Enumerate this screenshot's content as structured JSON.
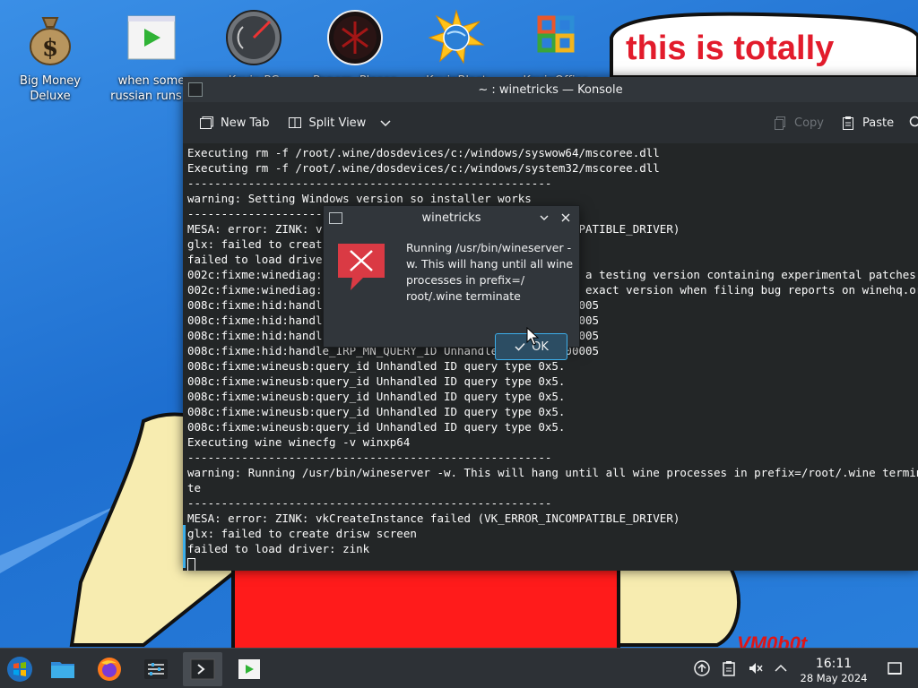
{
  "desktop": {
    "icons": [
      {
        "label": "Big Money Deluxe",
        "icon": "money-bag-icon"
      },
      {
        "label": "when some russian runs a",
        "icon": "video-player-icon"
      },
      {
        "label": "Kevin PC",
        "icon": "speedometer-icon"
      },
      {
        "label": "Papers, Please",
        "icon": "papers-please-icon"
      },
      {
        "label": "KevinBlast",
        "icon": "starburst-globe-icon"
      },
      {
        "label": "KevinOffice",
        "icon": "office-grid-icon"
      }
    ],
    "wallpaper_text": "this is totally",
    "watermark": "VM0b0t"
  },
  "konsole": {
    "title": "~ : winetricks — Konsole",
    "toolbar": {
      "new_tab": "New Tab",
      "split_view": "Split View",
      "copy": "Copy",
      "paste": "Paste"
    },
    "lines": [
      "Executing rm -f /root/.wine/dosdevices/c:/windows/syswow64/mscoree.dll",
      "Executing rm -f /root/.wine/dosdevices/c:/windows/system32/mscoree.dll",
      "------------------------------------------------------",
      "warning: Setting Windows version so installer works",
      "------------------------------------------------------",
      "MESA: error: ZINK: vkCreateInstance failed (VK_ERROR_INCOMPATIBLE_DRIVER)",
      "glx: failed to create drisw screen",
      "failed to load driver: zink",
      "002c:fixme:winediag:LdrInitializeThunk wine-staging 9.0 is a testing version containing experimental patches.",
      "002c:fixme:winediag:LdrInitializeThunk Please mention your exact version when filing bug reports on winehq.org.",
      "008c:fixme:hid:handle_IRP_MN_QUERY_ID Unhandled type 00000005",
      "008c:fixme:hid:handle_IRP_MN_QUERY_ID Unhandled type 00000005",
      "008c:fixme:hid:handle_IRP_MN_QUERY_ID Unhandled type 00000005",
      "008c:fixme:hid:handle_IRP_MN_QUERY_ID Unhandled type 00000005",
      "008c:fixme:wineusb:query_id Unhandled ID query type 0x5.",
      "008c:fixme:wineusb:query_id Unhandled ID query type 0x5.",
      "008c:fixme:wineusb:query_id Unhandled ID query type 0x5.",
      "008c:fixme:wineusb:query_id Unhandled ID query type 0x5.",
      "008c:fixme:wineusb:query_id Unhandled ID query type 0x5.",
      "Executing wine winecfg -v winxp64",
      "------------------------------------------------------",
      "warning: Running /usr/bin/wineserver -w. This will hang until all wine processes in prefix=/root/.wine termina",
      "te",
      "------------------------------------------------------",
      "MESA: error: ZINK: vkCreateInstance failed (VK_ERROR_INCOMPATIBLE_DRIVER)",
      "glx: failed to create drisw screen",
      "failed to load driver: zink"
    ]
  },
  "dialog": {
    "title": "winetricks",
    "message": "Running /usr/bin/wineserver -w. This will hang until all wine processes in prefix=/ root/.wine terminate",
    "ok_label": "OK"
  },
  "taskbar": {
    "apps": [
      "start-menu-icon",
      "file-manager-icon",
      "firefox-icon",
      "mixer-settings-icon",
      "konsole-icon",
      "video-player-icon"
    ],
    "clock": {
      "time": "16:11",
      "date": "28 May 2024"
    }
  },
  "colors": {
    "accent": "#3daee9",
    "error_red": "#da3a44",
    "terminal_bg": "#232627"
  }
}
